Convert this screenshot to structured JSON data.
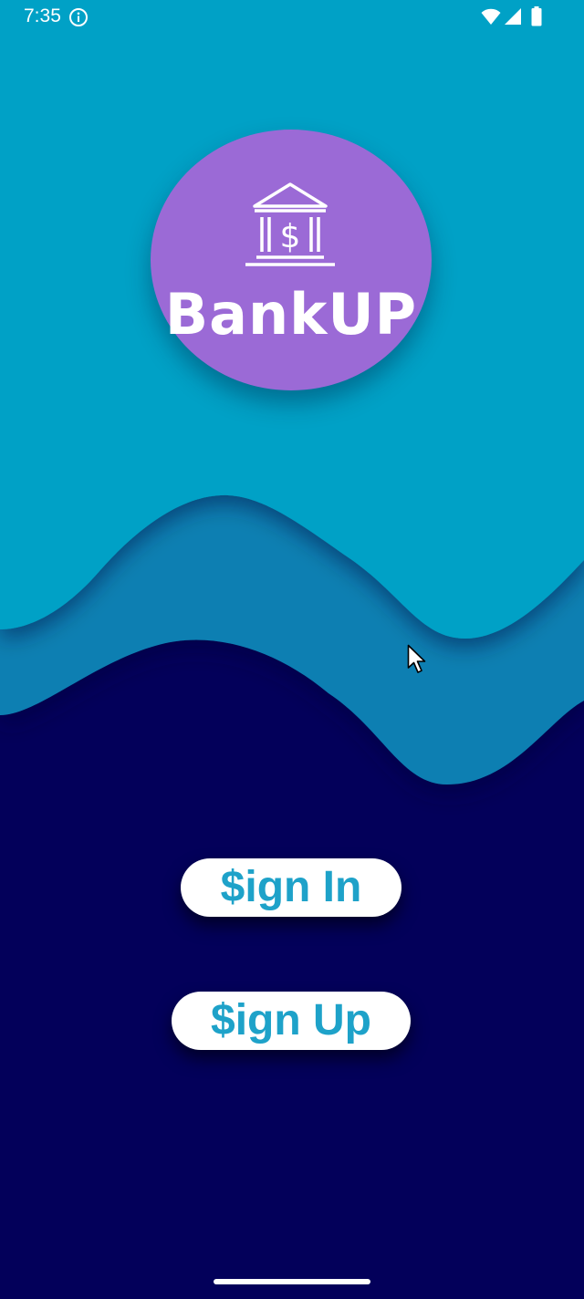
{
  "status_bar": {
    "time": "7:35",
    "icons": [
      "info-icon",
      "wifi-icon",
      "signal-icon",
      "battery-icon"
    ]
  },
  "logo": {
    "text": "BankUP",
    "icon": "bank-building-dollar-icon"
  },
  "buttons": {
    "sign_in": "$ign In",
    "sign_up": "$ign Up"
  },
  "colors": {
    "top_background": "#04a1c6",
    "middle_wave": "#0f7fb2",
    "bottom_background": "#03005a",
    "logo_circle": "#9b6ad6",
    "button_bg": "#ffffff",
    "button_text": "#1ea2c9"
  }
}
